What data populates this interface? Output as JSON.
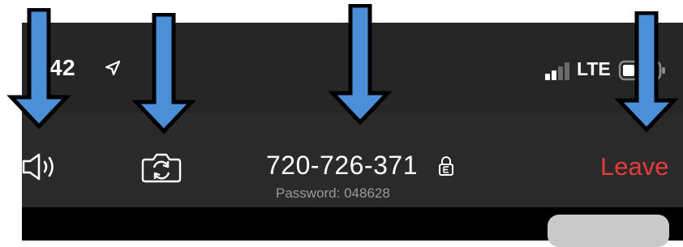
{
  "status_bar": {
    "time": "1:42",
    "network": "LTE",
    "icons": [
      "location-arrow-icon",
      "signal-bars-icon",
      "battery-icon"
    ]
  },
  "toolbar": {
    "speaker_icon": "speaker-icon",
    "camera_icon": "camera-switch-icon",
    "meeting_id": "720-726-371",
    "lock_icon": "lock-icon",
    "password": "Password: 048628",
    "leave_label": "Leave"
  },
  "annotations": {
    "arrow_count": 4,
    "arrow_color": "#4a8fd8",
    "arrow_outline": "#000000"
  },
  "colors": {
    "background": "#2a2a2a",
    "leave": "#e53b3b",
    "password_text": "#9a9a9a"
  }
}
